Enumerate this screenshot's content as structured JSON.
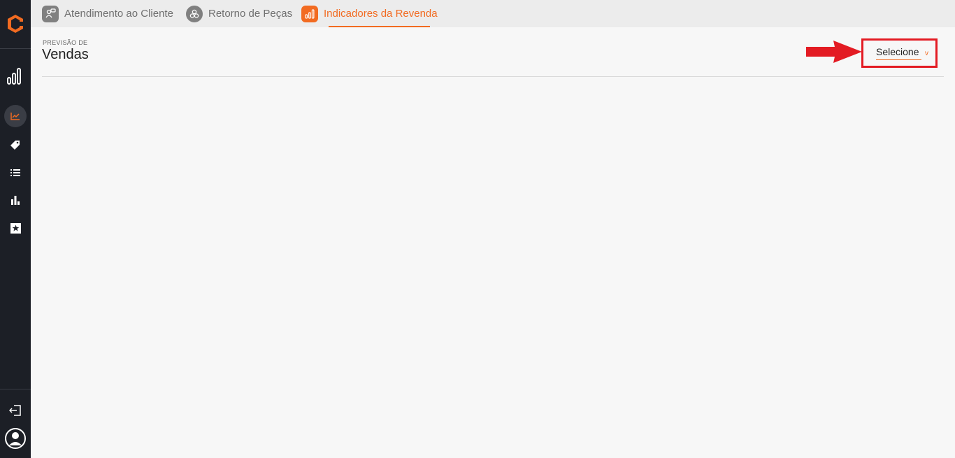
{
  "sidebar": {
    "logo_icon": "company-logo-icon",
    "nav_icons": [
      "bar-chart-icon",
      "line-chart-icon",
      "tag-icon",
      "list-icon",
      "stats-icon",
      "star-icon"
    ],
    "bottom_icons": [
      "logout-icon",
      "user-avatar-icon"
    ],
    "colors": {
      "background": "#1c1f26",
      "accent": "#f26b21"
    }
  },
  "tabs": [
    {
      "label": "Atendimento ao Cliente",
      "icon": "chat-users-icon",
      "active": false
    },
    {
      "label": "Retorno de Peças",
      "icon": "parts-icon",
      "active": false
    },
    {
      "label": "Indicadores da Revenda",
      "icon": "bar-chart-icon",
      "active": true
    }
  ],
  "header": {
    "eyebrow": "PREVISÃO DE",
    "title": "Vendas"
  },
  "selector": {
    "label": "Selecione",
    "caret": "v"
  },
  "annotation": {
    "color": "#e31b23"
  }
}
